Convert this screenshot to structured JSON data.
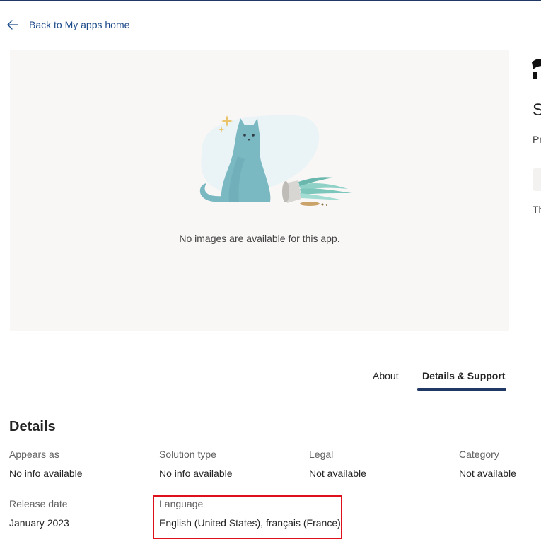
{
  "nav": {
    "back_label": "Back to My apps home",
    "back_icon": "arrow-left-icon"
  },
  "gallery": {
    "message": "No images are available for this app.",
    "illustration": "cat-with-plant-pot-illustration"
  },
  "app_header": {
    "name_partial": "S",
    "publisher_partial": "Pr",
    "text_partial": "Th",
    "logo_icon": "app-logo-icon"
  },
  "tabs": [
    {
      "label": "About",
      "selected": false
    },
    {
      "label": "Details & Support",
      "selected": true
    }
  ],
  "details": {
    "title": "Details",
    "fields": [
      {
        "label": "Appears as",
        "value": "No info available"
      },
      {
        "label": "Solution type",
        "value": "No info available"
      },
      {
        "label": "Legal",
        "value": "Not available"
      },
      {
        "label": "Category",
        "value": "Not available"
      },
      {
        "label": "Release date",
        "value": "January 2023"
      },
      {
        "label": "Language",
        "value": "English (United States), français (France)"
      }
    ]
  },
  "colors": {
    "accent": "#1f3864",
    "link": "#1b4a8a",
    "highlight": "#e0101a",
    "gallery_bg": "#f9f7f6"
  }
}
